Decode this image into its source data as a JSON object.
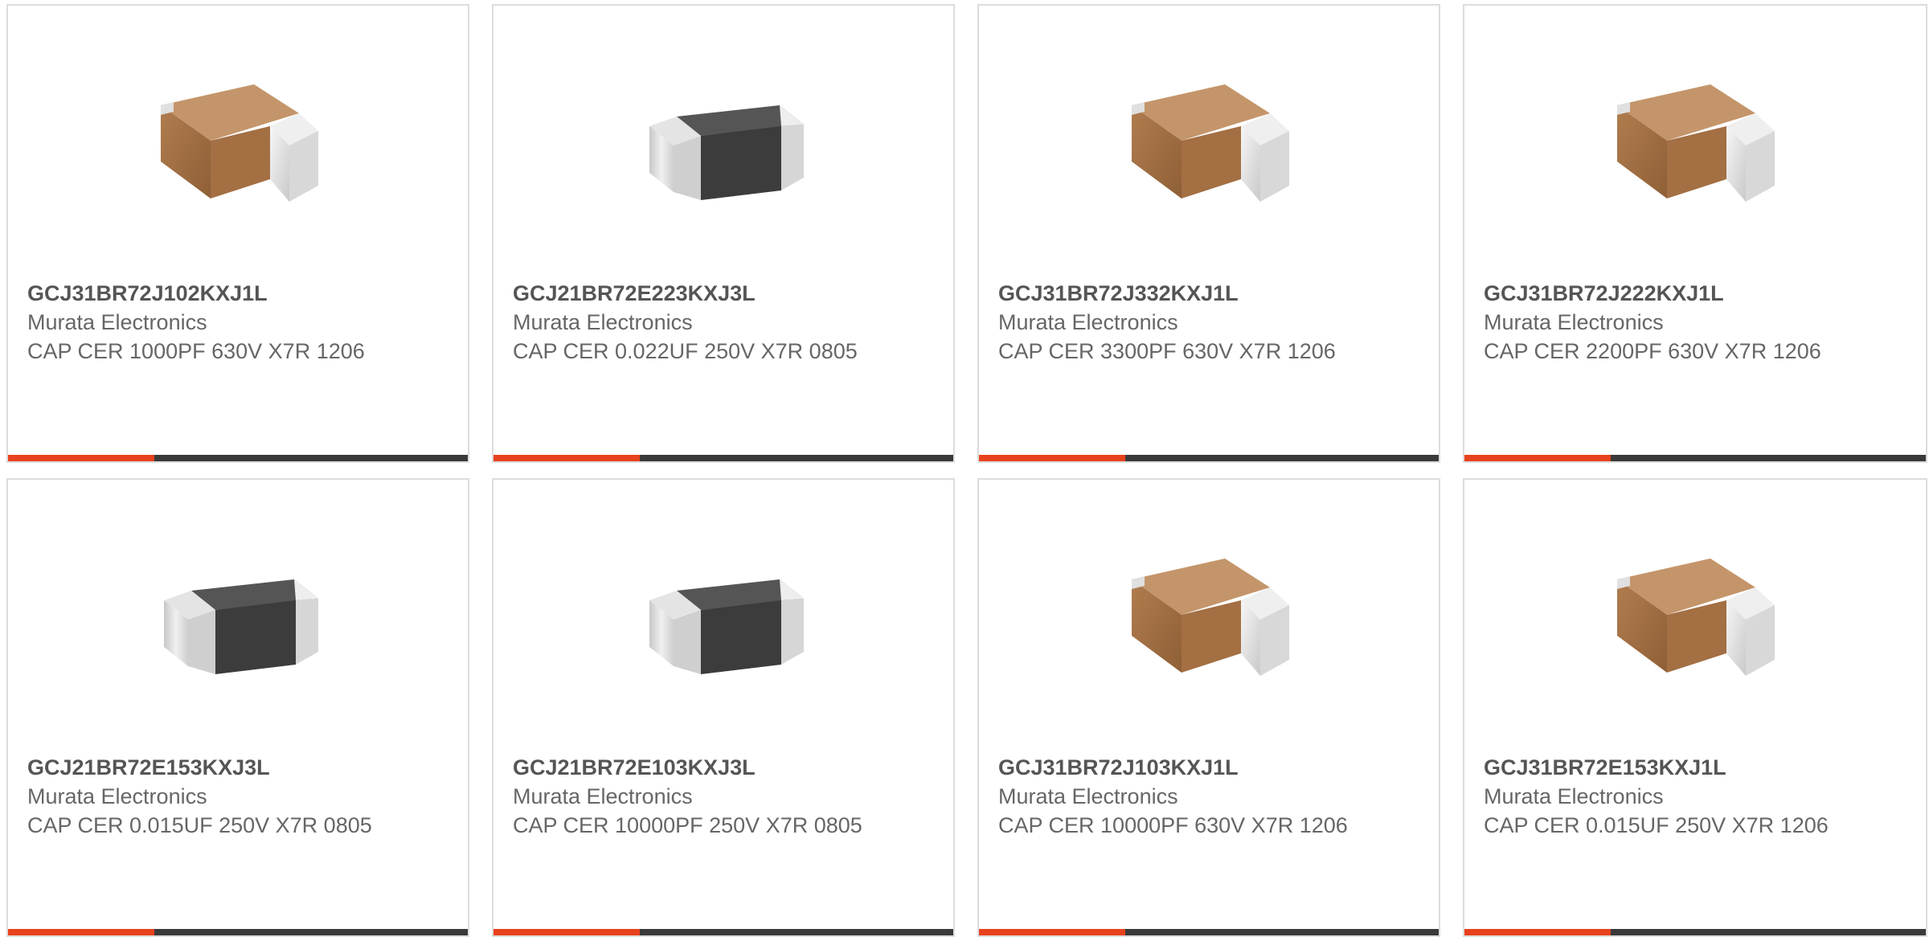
{
  "colors": {
    "accent": "#e8421c",
    "bar_dark": "#3a3a3a",
    "body_tan": "#a36f43",
    "body_dark": "#3c3c3c",
    "terminal": "#e9e9e9"
  },
  "cards": [
    {
      "part_number": "GCJ31BR72J102KXJ1L",
      "manufacturer": "Murata Electronics",
      "description": "CAP CER 1000PF 630V X7R 1206",
      "image": "capacitor-tan-icon"
    },
    {
      "part_number": "GCJ21BR72E223KXJ3L",
      "manufacturer": "Murata Electronics",
      "description": "CAP CER 0.022UF 250V X7R 0805",
      "image": "capacitor-dark-icon"
    },
    {
      "part_number": "GCJ31BR72J332KXJ1L",
      "manufacturer": "Murata Electronics",
      "description": "CAP CER 3300PF 630V X7R 1206",
      "image": "capacitor-tan-icon"
    },
    {
      "part_number": "GCJ31BR72J222KXJ1L",
      "manufacturer": "Murata Electronics",
      "description": "CAP CER 2200PF 630V X7R 1206",
      "image": "capacitor-tan-icon"
    },
    {
      "part_number": "GCJ21BR72E153KXJ3L",
      "manufacturer": "Murata Electronics",
      "description": "CAP CER 0.015UF 250V X7R 0805",
      "image": "capacitor-dark-icon"
    },
    {
      "part_number": "GCJ21BR72E103KXJ3L",
      "manufacturer": "Murata Electronics",
      "description": "CAP CER 10000PF 250V X7R 0805",
      "image": "capacitor-dark-icon"
    },
    {
      "part_number": "GCJ31BR72J103KXJ1L",
      "manufacturer": "Murata Electronics",
      "description": "CAP CER 10000PF 630V X7R 1206",
      "image": "capacitor-tan-icon"
    },
    {
      "part_number": "GCJ31BR72E153KXJ1L",
      "manufacturer": "Murata Electronics",
      "description": "CAP CER 0.015UF 250V X7R 1206",
      "image": "capacitor-tan-icon"
    }
  ]
}
